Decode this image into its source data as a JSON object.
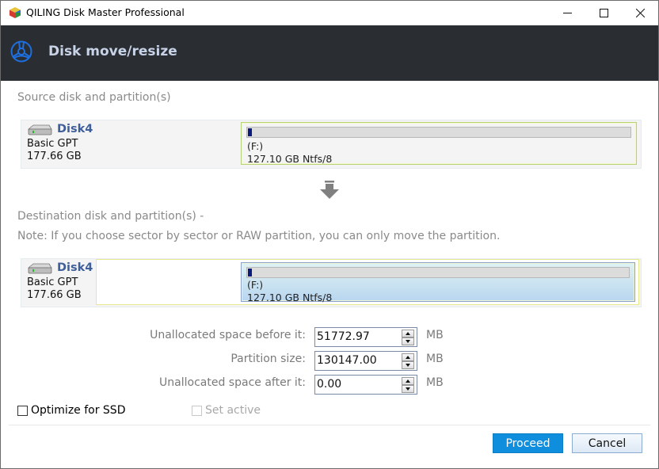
{
  "window": {
    "title": "QILING Disk Master Professional",
    "controls": [
      "minimize",
      "maximize",
      "close"
    ]
  },
  "header": {
    "icon": "steering-wheel-icon",
    "title": "Disk move/resize"
  },
  "source": {
    "label": "Source disk and partition(s)",
    "disk": {
      "name": "Disk4",
      "type": "Basic GPT",
      "size": "177.66 GB"
    },
    "partition": {
      "letter": "(F:)",
      "detail": "127.10 GB Ntfs/8",
      "used_fraction": 0.008
    }
  },
  "arrow_icon": "arrow-down-icon",
  "destination": {
    "label": "Destination disk and partition(s) -",
    "note": "Note: If you choose sector by sector or RAW partition, you can only move the partition.",
    "disk": {
      "name": "Disk4",
      "type": "Basic GPT",
      "size": "177.66 GB"
    },
    "partition": {
      "letter": "(F:)",
      "detail": "127.10 GB Ntfs/8",
      "used_fraction": 0.008,
      "offset_fraction": 0.2846
    }
  },
  "fields": [
    {
      "label": "Unallocated space before it:",
      "value": "51772.97",
      "unit": "MB"
    },
    {
      "label": "Partition size:",
      "value": "130147.00",
      "unit": "MB"
    },
    {
      "label": "Unallocated space after it:",
      "value": "0.00",
      "unit": "MB"
    }
  ],
  "options": {
    "optimize_ssd": {
      "label": "Optimize for SSD",
      "checked": false,
      "enabled": true
    },
    "set_active": {
      "label": "Set active",
      "checked": false,
      "enabled": false
    }
  },
  "buttons": {
    "proceed": "Proceed",
    "cancel": "Cancel"
  },
  "colors": {
    "header_bg": "#2a2d32",
    "accent": "#0f8ede",
    "disk_name": "#3f5f9a",
    "usage_fill": "#0c1a7a"
  }
}
